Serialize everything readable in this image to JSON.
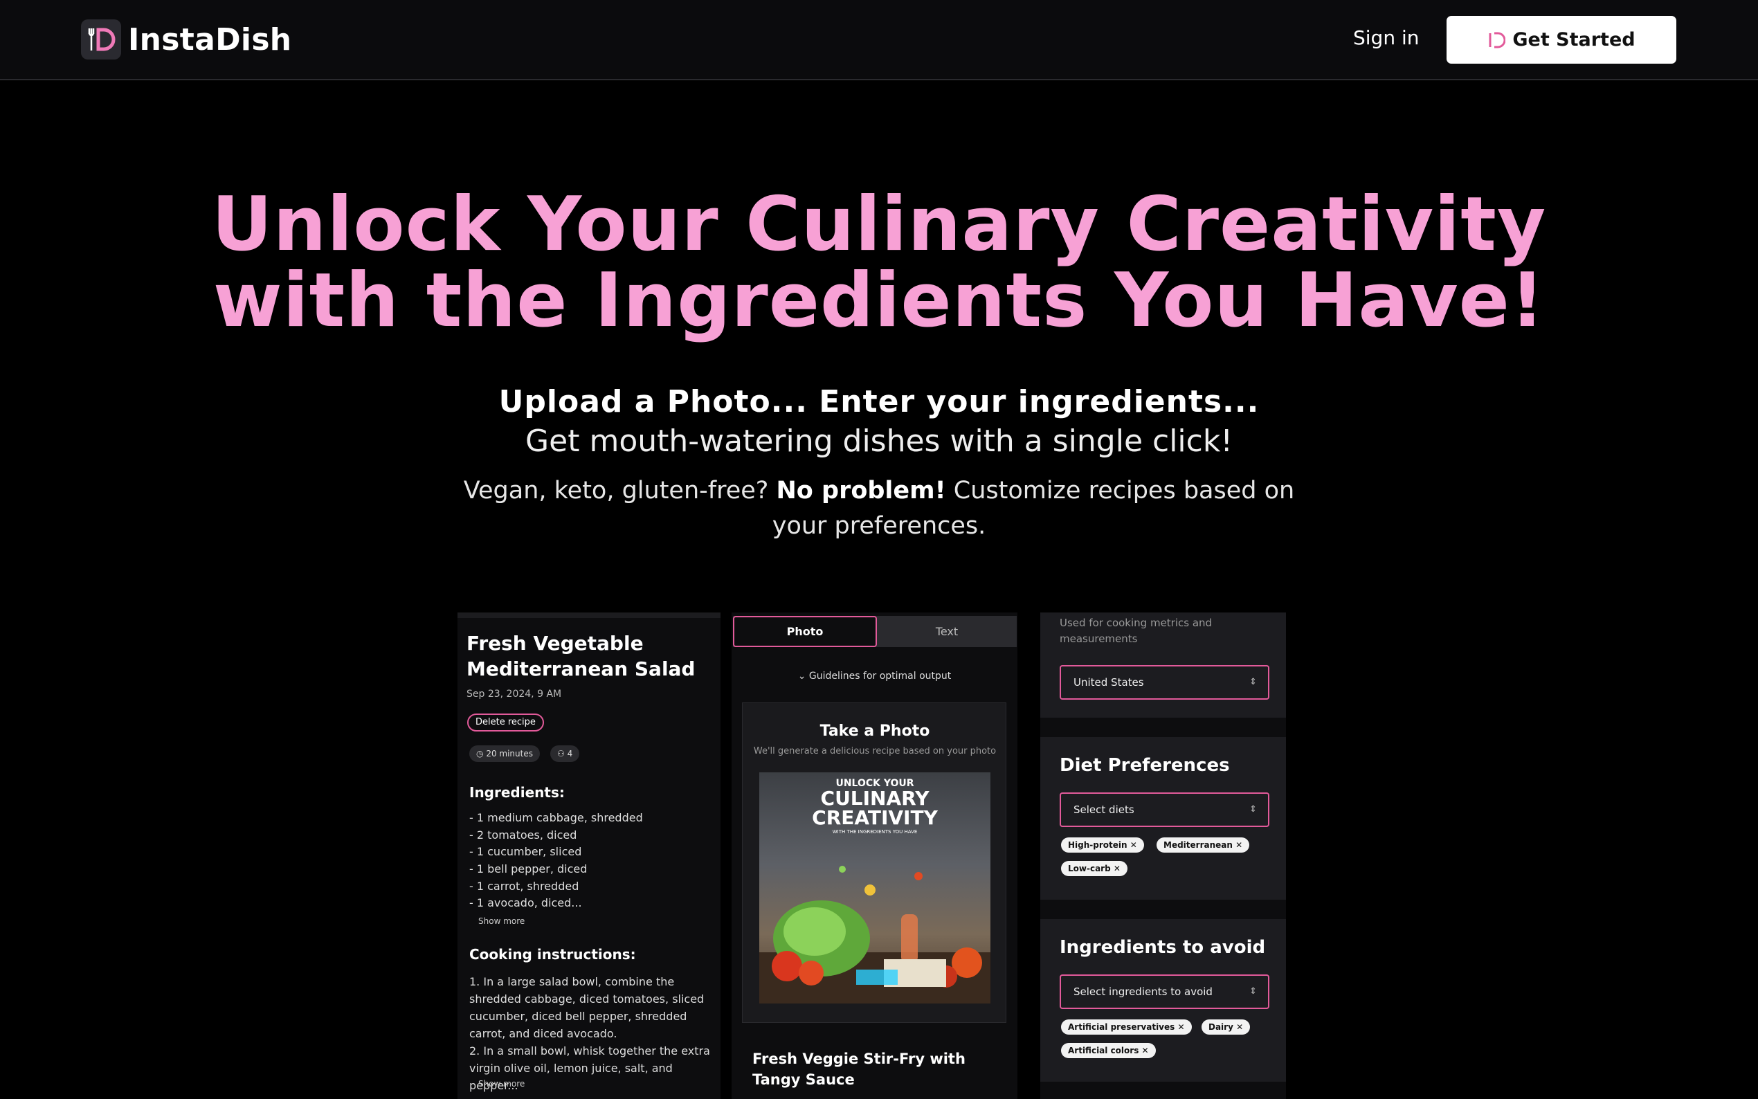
{
  "nav": {
    "brand": "InstaDish",
    "sign_in": "Sign in",
    "get_started": "Get Started"
  },
  "hero": {
    "title_line1": "Unlock Your Culinary Creativity",
    "title_line2": "with the Ingredients You Have!",
    "subtitle_bold": "Upload a Photo... Enter your ingredients...",
    "subtitle": "Get mouth-watering dishes with a single click!",
    "diets_pre": "Vegan, keto, gluten-free?",
    "diets_bold": "No problem!",
    "diets_post": "Customize recipes based on your preferences."
  },
  "recipe_preview": {
    "title": "Fresh Vegetable Mediterranean Salad",
    "date": "Sep 23, 2024, 9 AM",
    "delete_label": "Delete recipe",
    "time": "20 minutes",
    "servings": "4",
    "ingredients_heading": "Ingredients:",
    "ingredients": [
      "- 1 medium cabbage, shredded",
      "- 2 tomatoes, diced",
      "- 1 cucumber, sliced",
      "- 1 bell pepper, diced",
      "- 1 carrot, shredded",
      "- 1 avocado, diced..."
    ],
    "show_more": "Show more",
    "instructions_heading": "Cooking instructions:",
    "instructions": "1. In a large salad bowl, combine the shredded cabbage, diced tomatoes, sliced cucumber, diced bell pepper, shredded carrot, and diced avocado.\n2. In a small bowl, whisk together the extra virgin olive oil, lemon juice, salt, and pepper...",
    "show_more_2": "Show more"
  },
  "photo_preview": {
    "tab_photo": "Photo",
    "tab_text": "Text",
    "guidelines": "Guidelines for optimal output",
    "card_title": "Take a Photo",
    "card_sub": "We'll generate a delicious recipe based on your photo",
    "image_text_1": "UNLOCK YOUR",
    "image_text_2": "CULINARY CREATIVITY",
    "image_text_3": "WITH THE INGREDIENTS YOU HAVE",
    "caption": "Fresh Veggie Stir-Fry with Tangy Sauce"
  },
  "settings_preview": {
    "metrics_desc": "Used for cooking metrics and measurements",
    "country": "United States",
    "diet_title": "Diet Preferences",
    "diet_placeholder": "Select diets",
    "diet_tags": [
      "High-protein",
      "Mediterranean",
      "Low-carb"
    ],
    "avoid_title": "Ingredients to avoid",
    "avoid_placeholder": "Select ingredients to avoid",
    "avoid_tags": [
      "Artificial preservatives",
      "Dairy",
      "Artificial colors"
    ]
  },
  "colors": {
    "accent_pink": "#f7a1d5",
    "border_pink": "#e25a9a",
    "background": "#000000"
  }
}
